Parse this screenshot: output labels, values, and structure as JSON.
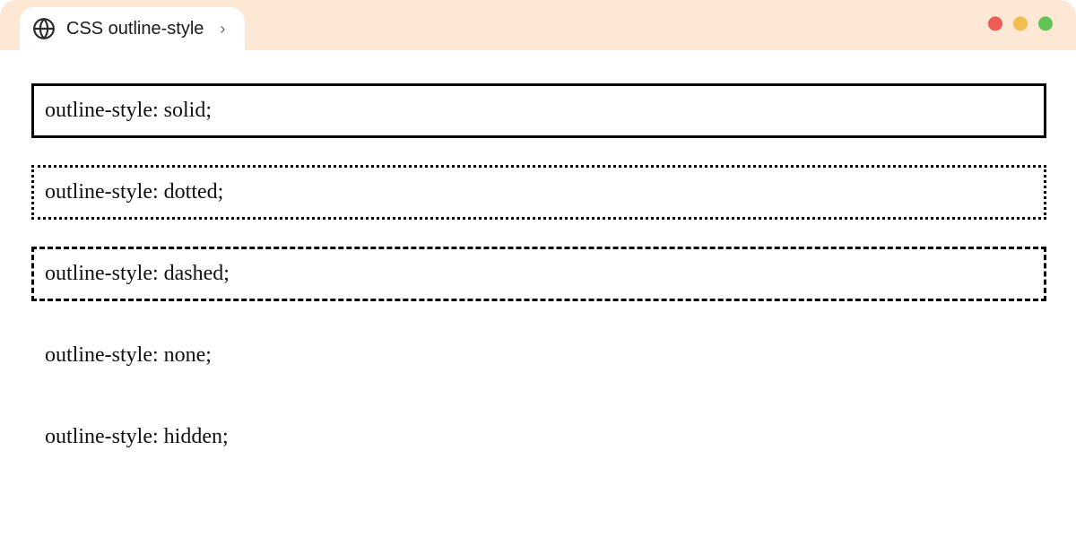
{
  "tab": {
    "title": "CSS outline-style"
  },
  "examples": [
    {
      "label": "outline-style: solid;",
      "style": "solid"
    },
    {
      "label": "outline-style: dotted;",
      "style": "dotted"
    },
    {
      "label": "outline-style: dashed;",
      "style": "dashed"
    },
    {
      "label": "outline-style: none;",
      "style": "none"
    },
    {
      "label": "outline-style: hidden;",
      "style": "hidden"
    }
  ]
}
